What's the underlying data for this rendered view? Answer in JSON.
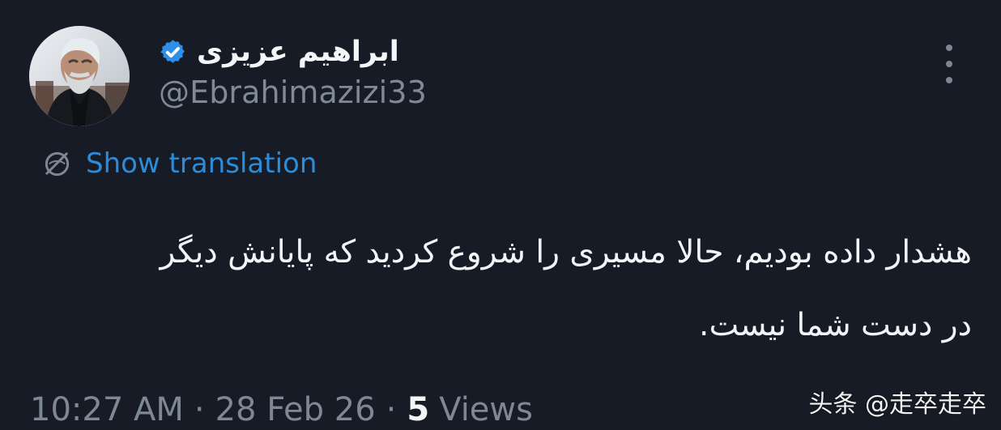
{
  "tweet": {
    "display_name": "ابراهیم عزیزی",
    "handle": "@Ebrahimazizi33",
    "verified_icon": "verified-badge-icon",
    "more_icon": "more-vertical-icon",
    "translation_icon": "translation-globe-icon",
    "translation_label": "Show translation",
    "body_lines": [
      "هشدار داده بودیم، حالا مسیری را شروع کردید که پایانش دیگر",
      "در دست شما نیست."
    ],
    "time": "10:27 AM",
    "date": "28 Feb 26",
    "views_count": "5",
    "views_label": "Views"
  },
  "watermark": {
    "text": "头条 @走卒走卒"
  },
  "colors": {
    "background": "#161b25",
    "primary_text": "#f2f5f7",
    "secondary_text": "#7e8894",
    "link_blue": "#2c8cd8",
    "verified_blue": "#2f8fe8"
  }
}
